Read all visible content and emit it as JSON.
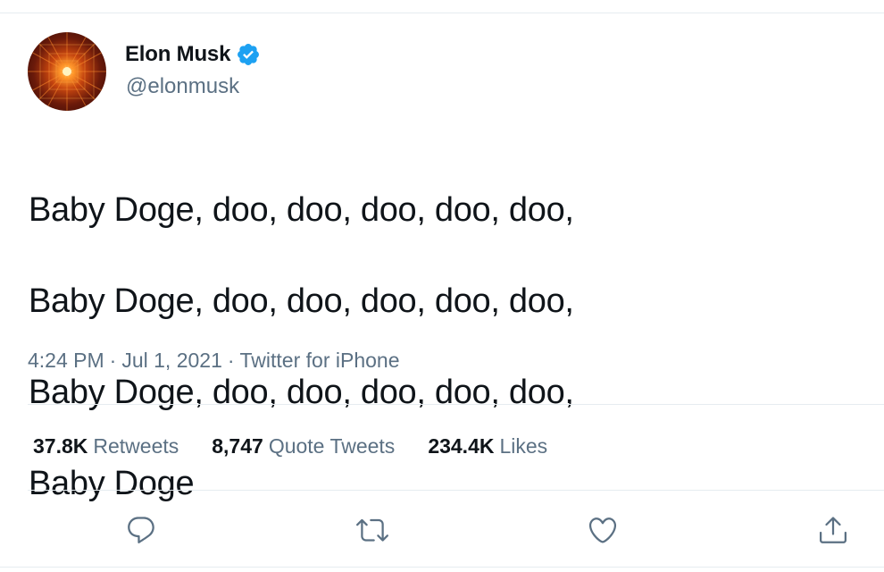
{
  "author": {
    "display_name": "Elon Musk",
    "handle": "@elonmusk",
    "verified": true,
    "avatar_icon": "fractal-avatar"
  },
  "tweet": {
    "lines": [
      "Baby Doge, doo, doo, doo, doo, doo,",
      "Baby Doge, doo, doo, doo, doo, doo,",
      "Baby Doge, doo, doo, doo, doo, doo,",
      "Baby Doge"
    ]
  },
  "meta": {
    "time": "4:24 PM",
    "separator": "·",
    "date": "Jul 1, 2021",
    "source": "Twitter for iPhone"
  },
  "stats": {
    "retweets": {
      "value": "37.8K",
      "label": "Retweets"
    },
    "quotes": {
      "value": "8,747",
      "label": "Quote Tweets"
    },
    "likes": {
      "value": "234.4K",
      "label": "Likes"
    }
  },
  "actions": {
    "reply_icon": "reply-icon",
    "retweet_icon": "retweet-icon",
    "like_icon": "heart-icon",
    "share_icon": "share-icon"
  },
  "colors": {
    "text": "#0f1419",
    "secondary": "#5b7083",
    "verified": "#1da1f2",
    "divider": "#e6ecf0"
  }
}
